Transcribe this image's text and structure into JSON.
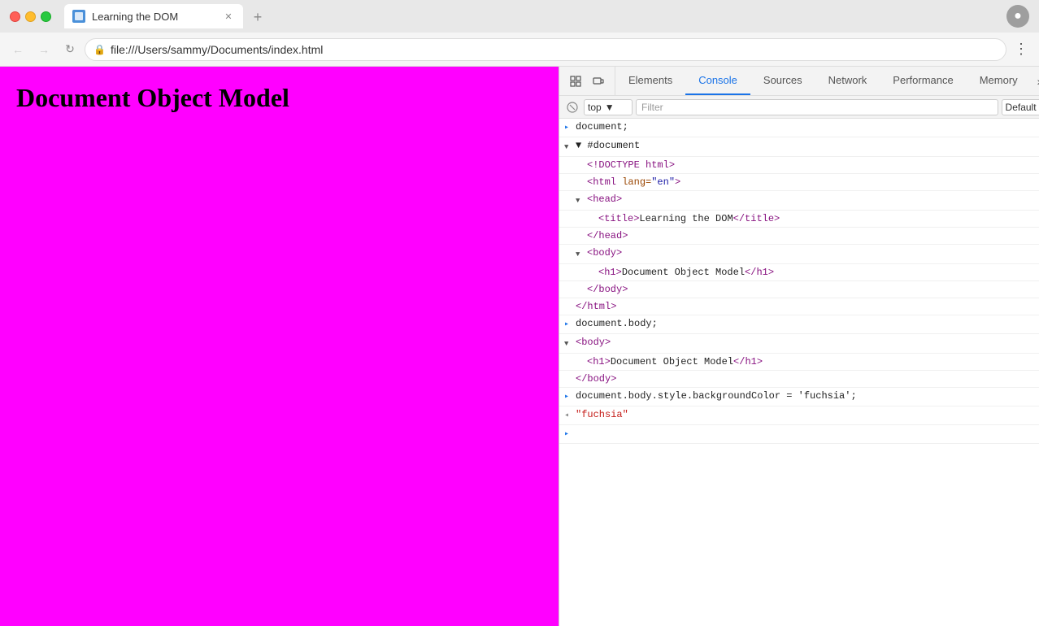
{
  "browser": {
    "tab_title": "Learning the DOM",
    "tab_favicon_alt": "page-icon",
    "address": "file:///Users/sammy/Documents/index.html",
    "new_tab_label": "+"
  },
  "devtools": {
    "tabs": [
      {
        "id": "elements",
        "label": "Elements",
        "active": false
      },
      {
        "id": "console",
        "label": "Console",
        "active": true
      },
      {
        "id": "sources",
        "label": "Sources",
        "active": false
      },
      {
        "id": "network",
        "label": "Network",
        "active": false
      },
      {
        "id": "performance",
        "label": "Performance",
        "active": false
      },
      {
        "id": "memory",
        "label": "Memory",
        "active": false
      }
    ],
    "console": {
      "context": "top",
      "filter_placeholder": "Filter",
      "level": "Default levels"
    }
  },
  "page": {
    "heading": "Document Object Model",
    "bg_color": "#ff00ff"
  },
  "console_lines": [
    {
      "indent": 0,
      "arrow": ">",
      "content_html": "<span class='c-dark'>document;</span>"
    },
    {
      "indent": 0,
      "arrow": "▼",
      "content_html": "<span class='c-dark'>▼ #document</span>"
    },
    {
      "indent": 1,
      "arrow": "",
      "content_html": "<span class='c-tag'>&lt;!DOCTYPE html&gt;</span>"
    },
    {
      "indent": 1,
      "arrow": "",
      "content_html": "<span class='c-tag'>&lt;html</span> <span class='c-attr'>lang=</span><span class='c-val'>\"en\"</span><span class='c-tag'>&gt;</span>"
    },
    {
      "indent": 1,
      "arrow": "▼",
      "content_html": "<span class='c-tag'>&lt;head&gt;</span>"
    },
    {
      "indent": 2,
      "arrow": "",
      "content_html": "<span class='c-tag'>&lt;title&gt;</span><span class='c-dark'>Learning the DOM</span><span class='c-tag'>&lt;/title&gt;</span>"
    },
    {
      "indent": 1,
      "arrow": "",
      "content_html": "<span class='c-tag'>&lt;/head&gt;</span>"
    },
    {
      "indent": 1,
      "arrow": "▼",
      "content_html": "<span class='c-tag'>&lt;body&gt;</span>"
    },
    {
      "indent": 2,
      "arrow": "",
      "content_html": "<span class='c-tag'>&lt;h1&gt;</span><span class='c-dark'>Document Object Model</span><span class='c-tag'>&lt;/h1&gt;</span>"
    },
    {
      "indent": 1,
      "arrow": "",
      "content_html": "<span class='c-tag'>&lt;/body&gt;</span>"
    },
    {
      "indent": 0,
      "arrow": "",
      "content_html": "<span class='c-tag'>&lt;/html&gt;</span>"
    },
    {
      "indent": 0,
      "arrow": ">",
      "content_html": "<span class='c-dark'>document.body;</span>"
    },
    {
      "indent": 0,
      "arrow": "▼",
      "content_html": "<span class='c-tag'>&lt;body&gt;</span>"
    },
    {
      "indent": 1,
      "arrow": "",
      "content_html": "<span class='c-tag'>&lt;h1&gt;</span><span class='c-dark'>Document Object Model</span><span class='c-tag'>&lt;/h1&gt;</span>"
    },
    {
      "indent": 0,
      "arrow": "",
      "content_html": "<span class='c-tag'>&lt;/body&gt;</span>"
    },
    {
      "indent": 0,
      "arrow": ">",
      "content_html": "<span class='c-dark'>document.body.style.backgroundColor = 'fuchsia';</span>"
    },
    {
      "indent": 0,
      "arrow": "<",
      "content_html": "<span class='c-string'>\"fuchsia\"</span>"
    },
    {
      "indent": 0,
      "arrow": ">",
      "content_html": ""
    }
  ]
}
